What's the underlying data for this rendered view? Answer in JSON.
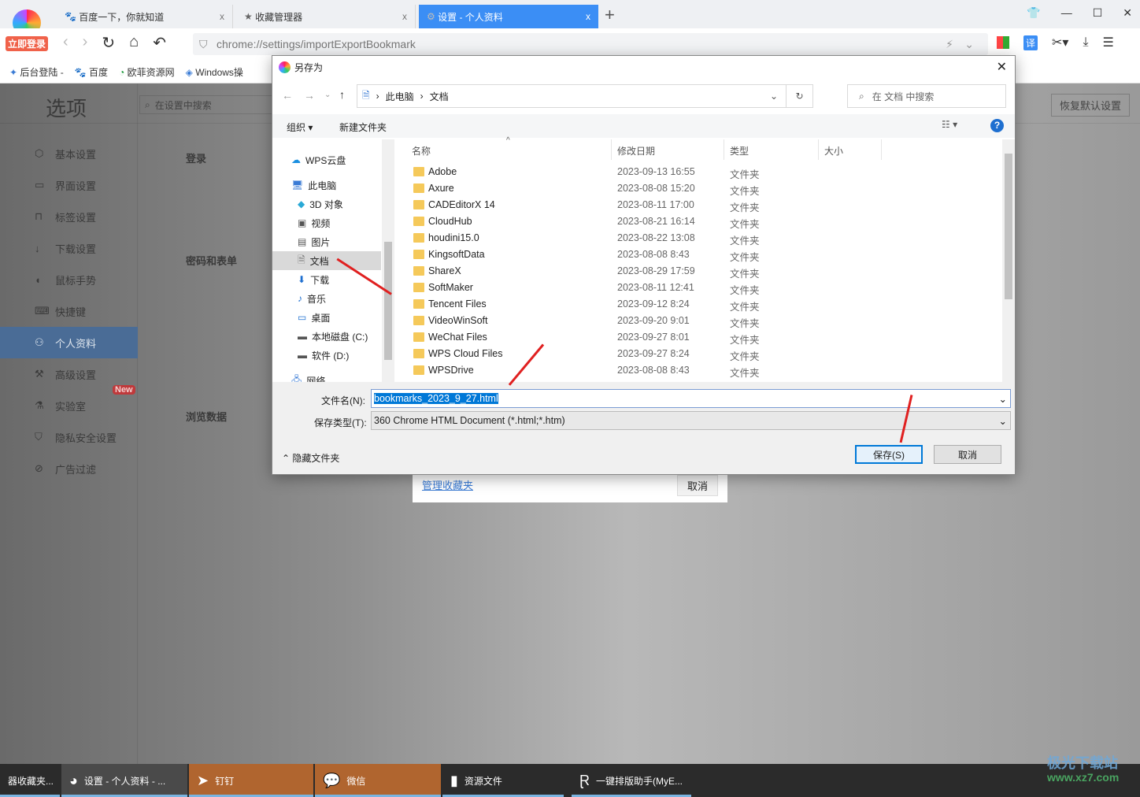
{
  "browser": {
    "login_badge": "立即登录",
    "tabs": [
      {
        "label": "百度一下，你就知道",
        "icon": "baidu-paw-icon"
      },
      {
        "label": "收藏管理器",
        "icon": "star-icon"
      },
      {
        "label": "设置 - 个人资料",
        "icon": "gear-icon",
        "active": true
      }
    ],
    "new_tab": "+",
    "close": "x",
    "url": "chrome://settings/importExportBookmark",
    "bookmarks": [
      "后台登陆 -",
      "百度",
      "欧菲资源网",
      "Windows操"
    ],
    "translate_label": "译",
    "accent_color": "#3b8ef5"
  },
  "settings": {
    "title": "选项",
    "search_placeholder": "在设置中搜索",
    "restore_default": "恢复默认设置",
    "sidebar": [
      {
        "label": "基本设置",
        "icon": "hexagon-gear-icon"
      },
      {
        "label": "界面设置",
        "icon": "window-icon"
      },
      {
        "label": "标签设置",
        "icon": "tab-icon"
      },
      {
        "label": "下载设置",
        "icon": "download-icon"
      },
      {
        "label": "鼠标手势",
        "icon": "mouse-icon"
      },
      {
        "label": "快捷键",
        "icon": "keyboard-icon"
      },
      {
        "label": "个人资料",
        "icon": "user-icon",
        "active": true
      },
      {
        "label": "高级设置",
        "icon": "wrench-icon"
      },
      {
        "label": "实验室",
        "icon": "flask-icon",
        "badge": "New"
      },
      {
        "label": "隐私安全设置",
        "icon": "shield-icon"
      },
      {
        "label": "广告过滤",
        "icon": "block-icon"
      }
    ],
    "sections": [
      "登录",
      "密码和表单",
      "浏览数据"
    ],
    "underlay_link": "管理收藏夹",
    "underlay_cancel": "取消"
  },
  "dialog": {
    "title": "另存为",
    "breadcrumb": [
      "此电脑",
      "文档"
    ],
    "search_placeholder": "在 文档 中搜索",
    "organize": "组织 ▾",
    "new_folder": "新建文件夹",
    "help": "?",
    "nav": [
      {
        "label": "WPS云盘",
        "icon": "cloud-icon"
      },
      {
        "label": "此电脑",
        "icon": "computer-icon"
      },
      {
        "label": "3D 对象",
        "icon": "cube-icon"
      },
      {
        "label": "视频",
        "icon": "video-icon"
      },
      {
        "label": "图片",
        "icon": "picture-icon"
      },
      {
        "label": "文档",
        "icon": "document-icon",
        "selected": true
      },
      {
        "label": "下载",
        "icon": "download-arrow-icon"
      },
      {
        "label": "音乐",
        "icon": "music-icon"
      },
      {
        "label": "桌面",
        "icon": "desktop-icon"
      },
      {
        "label": "本地磁盘 (C:)",
        "icon": "drive-icon"
      },
      {
        "label": "软件 (D:)",
        "icon": "drive-icon"
      },
      {
        "label": "网络",
        "icon": "network-icon"
      }
    ],
    "columns": [
      "名称",
      "修改日期",
      "类型",
      "大小"
    ],
    "files": [
      {
        "name": "Adobe",
        "date": "2023-09-13 16:55",
        "type": "文件夹"
      },
      {
        "name": "Axure",
        "date": "2023-08-08 15:20",
        "type": "文件夹"
      },
      {
        "name": "CADEditorX 14",
        "date": "2023-08-11 17:00",
        "type": "文件夹"
      },
      {
        "name": "CloudHub",
        "date": "2023-08-21 16:14",
        "type": "文件夹"
      },
      {
        "name": "houdini15.0",
        "date": "2023-08-22 13:08",
        "type": "文件夹"
      },
      {
        "name": "KingsoftData",
        "date": "2023-08-08 8:43",
        "type": "文件夹"
      },
      {
        "name": "ShareX",
        "date": "2023-08-29 17:59",
        "type": "文件夹"
      },
      {
        "name": "SoftMaker",
        "date": "2023-08-11 12:41",
        "type": "文件夹"
      },
      {
        "name": "Tencent Files",
        "date": "2023-09-12 8:24",
        "type": "文件夹"
      },
      {
        "name": "VideoWinSoft",
        "date": "2023-09-20 9:01",
        "type": "文件夹"
      },
      {
        "name": "WeChat Files",
        "date": "2023-09-27 8:01",
        "type": "文件夹"
      },
      {
        "name": "WPS Cloud Files",
        "date": "2023-09-27 8:24",
        "type": "文件夹"
      },
      {
        "name": "WPSDrive",
        "date": "2023-08-08 8:43",
        "type": "文件夹"
      }
    ],
    "filename_label": "文件名(N):",
    "filename_value": "bookmarks_2023_9_27.html",
    "filetype_label": "保存类型(T):",
    "filetype_value": "360 Chrome HTML Document (*.html;*.htm)",
    "hide_folders": "隐藏文件夹",
    "save": "保存(S)",
    "cancel": "取消"
  },
  "taskbar": {
    "items": [
      {
        "label": "器收藏夹..."
      },
      {
        "label": "设置 - 个人资料 - ..."
      },
      {
        "label": "钉钉",
        "color": "#b0652f"
      },
      {
        "label": "微信",
        "color": "#b0652f"
      },
      {
        "label": "资源文件"
      },
      {
        "label": "一键排版助手(MyE..."
      }
    ],
    "watermark": "极光下载站",
    "watermark_url": "www.xz7.com"
  }
}
